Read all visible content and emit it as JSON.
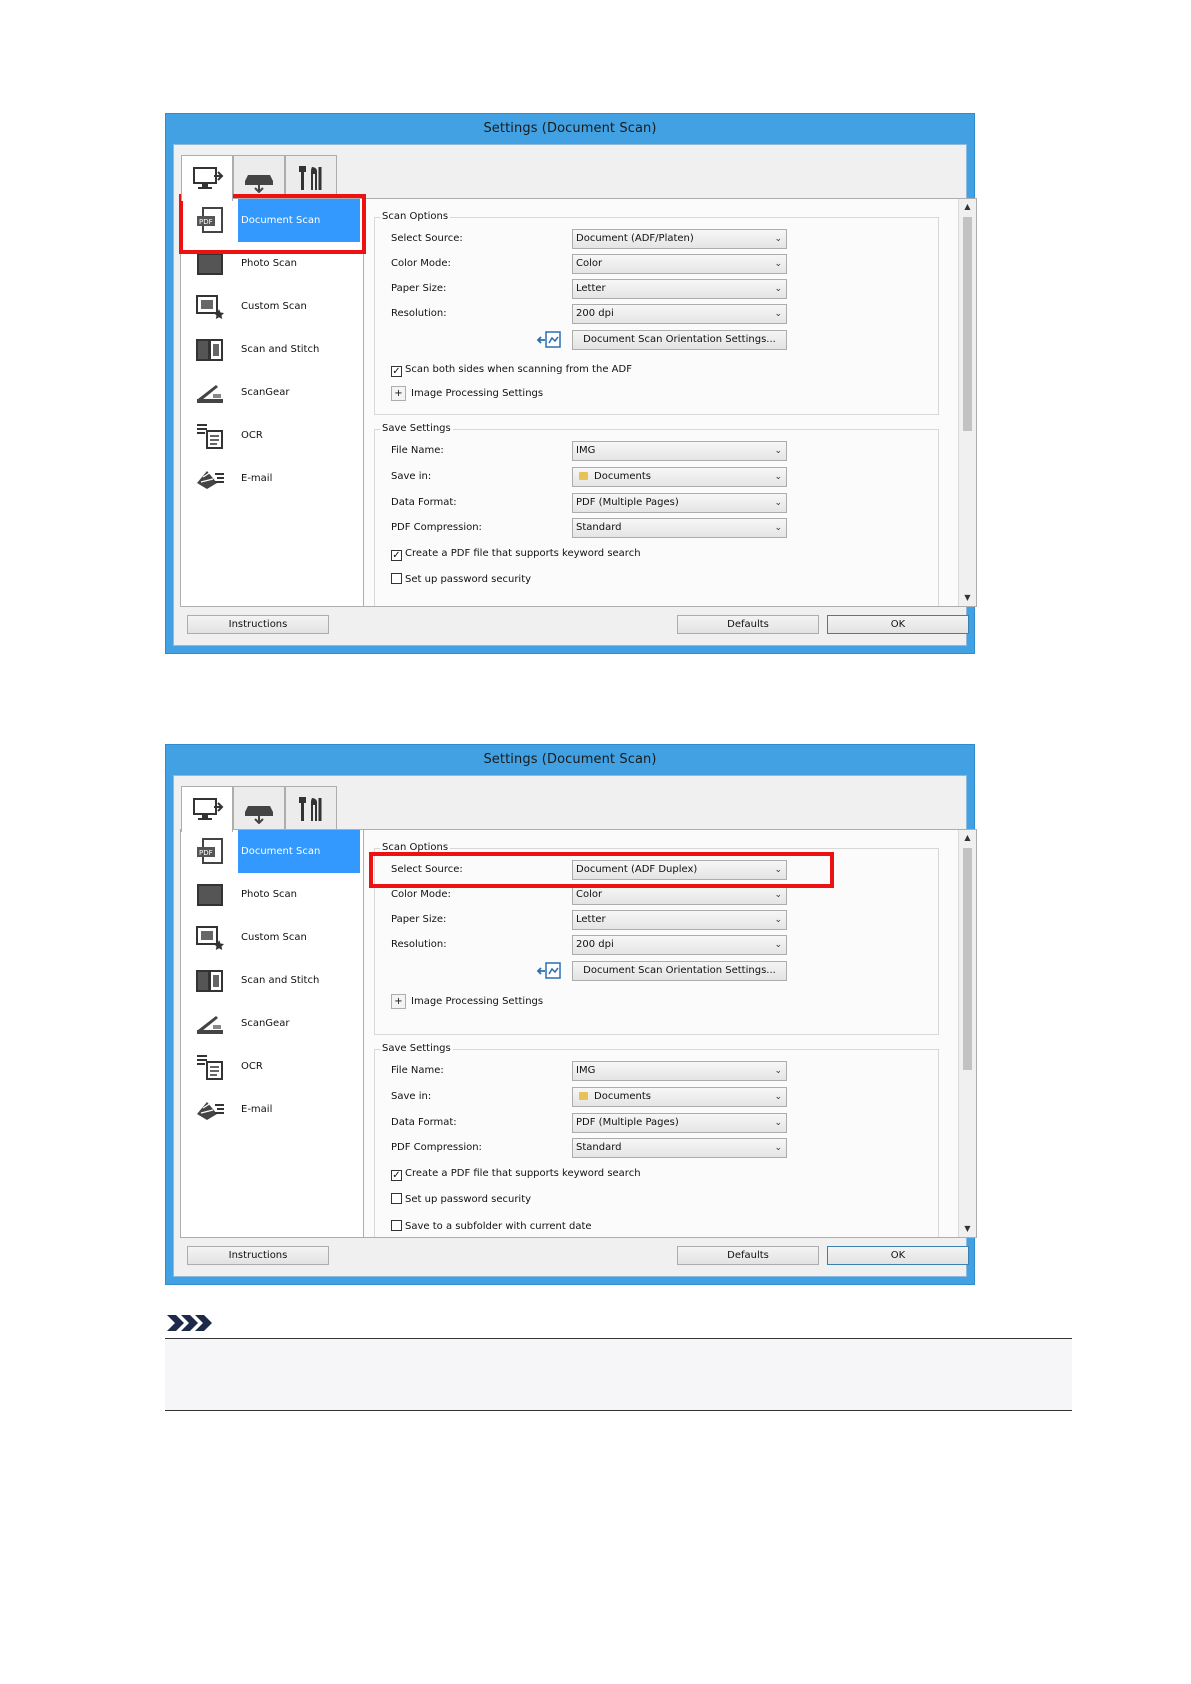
{
  "screens": [
    {
      "title": "Settings (Document Scan)",
      "sidebar": [
        {
          "label": "Document Scan",
          "icon": "pdf-document-icon",
          "selected": true
        },
        {
          "label": "Photo Scan",
          "icon": "photo-icon",
          "selected": false
        },
        {
          "label": "Custom Scan",
          "icon": "custom-scan-icon",
          "selected": false
        },
        {
          "label": "Scan and Stitch",
          "icon": "stitch-icon",
          "selected": false
        },
        {
          "label": "ScanGear",
          "icon": "scangear-icon",
          "selected": false
        },
        {
          "label": "OCR",
          "icon": "ocr-icon",
          "selected": false
        },
        {
          "label": "E-mail",
          "icon": "email-icon",
          "selected": false
        }
      ],
      "scan_options": {
        "title": "Scan Options",
        "select_source_label": "Select Source:",
        "select_source_value": "Document (ADF/Platen)",
        "color_mode_label": "Color Mode:",
        "color_mode_value": "Color",
        "paper_size_label": "Paper Size:",
        "paper_size_value": "Letter",
        "resolution_label": "Resolution:",
        "resolution_value": "200 dpi",
        "orientation_button": "Document Scan Orientation Settings...",
        "scan_both_sides_label": "Scan both sides when scanning from the ADF",
        "scan_both_sides_checked": true,
        "image_processing_label": "Image Processing Settings"
      },
      "save_settings": {
        "title": "Save Settings",
        "file_name_label": "File Name:",
        "file_name_value": "IMG",
        "save_in_label": "Save in:",
        "save_in_value": "Documents",
        "data_format_label": "Data Format:",
        "data_format_value": "PDF (Multiple Pages)",
        "pdf_compression_label": "PDF Compression:",
        "pdf_compression_value": "Standard",
        "keyword_search_label": "Create a PDF file that supports keyword search",
        "keyword_search_checked": true,
        "password_label": "Set up password security",
        "password_checked": false
      },
      "buttons": {
        "instructions": "Instructions",
        "defaults": "Defaults",
        "ok": "OK"
      }
    },
    {
      "title": "Settings (Document Scan)",
      "sidebar": [
        {
          "label": "Document Scan",
          "icon": "pdf-document-icon",
          "selected": true
        },
        {
          "label": "Photo Scan",
          "icon": "photo-icon",
          "selected": false
        },
        {
          "label": "Custom Scan",
          "icon": "custom-scan-icon",
          "selected": false
        },
        {
          "label": "Scan and Stitch",
          "icon": "stitch-icon",
          "selected": false
        },
        {
          "label": "ScanGear",
          "icon": "scangear-icon",
          "selected": false
        },
        {
          "label": "OCR",
          "icon": "ocr-icon",
          "selected": false
        },
        {
          "label": "E-mail",
          "icon": "email-icon",
          "selected": false
        }
      ],
      "scan_options": {
        "title": "Scan Options",
        "select_source_label": "Select Source:",
        "select_source_value": "Document (ADF Duplex)",
        "color_mode_label": "Color Mode:",
        "color_mode_value": "Color",
        "paper_size_label": "Paper Size:",
        "paper_size_value": "Letter",
        "resolution_label": "Resolution:",
        "resolution_value": "200 dpi",
        "orientation_button": "Document Scan Orientation Settings...",
        "image_processing_label": "Image Processing Settings"
      },
      "save_settings": {
        "title": "Save Settings",
        "file_name_label": "File Name:",
        "file_name_value": "IMG",
        "save_in_label": "Save in:",
        "save_in_value": "Documents",
        "data_format_label": "Data Format:",
        "data_format_value": "PDF (Multiple Pages)",
        "pdf_compression_label": "PDF Compression:",
        "pdf_compression_value": "Standard",
        "keyword_search_label": "Create a PDF file that supports keyword search",
        "keyword_search_checked": true,
        "password_label": "Set up password security",
        "password_checked": false,
        "subfolder_label": "Save to a subfolder with current date",
        "subfolder_checked": false
      },
      "buttons": {
        "instructions": "Instructions",
        "defaults": "Defaults",
        "ok": "OK"
      }
    }
  ],
  "colors": {
    "title_bar": "#41a1e3",
    "selection": "#3399ff",
    "highlight": "#e11111"
  }
}
